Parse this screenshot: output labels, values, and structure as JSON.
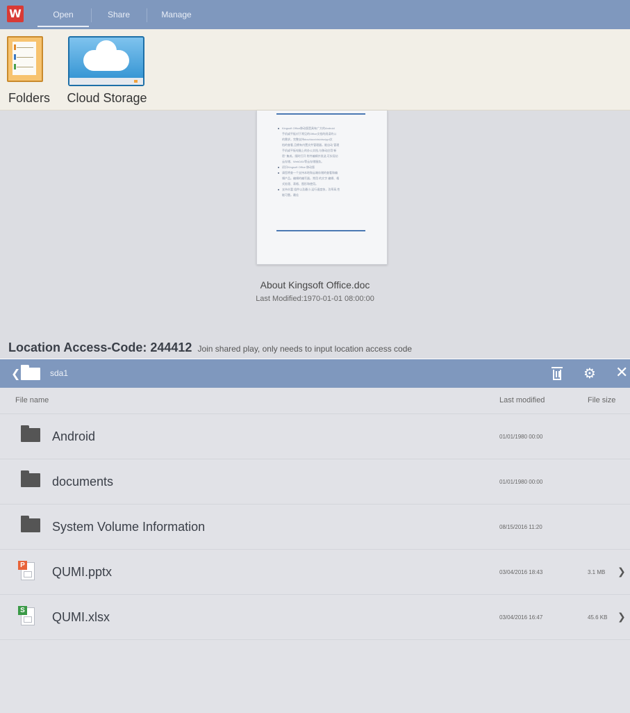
{
  "tabs": [
    "Open",
    "Share",
    "Manage"
  ],
  "ribbon": {
    "folders_label": "Folders",
    "cloud_label": "Cloud Storage"
  },
  "preview": {
    "doc_lines": [
      "Kingsoft Office移动版是具有广大的Android",
      "手机或平板对于常见的Office文档的阅读的公",
      "的需求，完整支持doc/docx/xls/xlsx/ppt文",
      "档的查看,且拥有内置文件管理器，能自动 管理",
      "手机或平板电脑上的办公文档,与移动应用\"新",
      "密\" 集成，随时打开 附件编辑并发送,可实现访",
      "云存储、WebDAV等云存储服务。",
      "初识Kingsoft Office 移动版",
      "请您将查一个支持本地和云端存储的查看和编",
      "辑产品。编辑的编写器，常用 的文字 编辑、格",
      "式处理、表格、图形和使用。",
      "支持丰富 组件以及最小,运行速度快，功率高,性",
      "能可靠。最佳"
    ],
    "doc_name": "About Kingsoft Office.doc",
    "doc_modified": "Last Modified:1970-01-01 08:00:00"
  },
  "access": {
    "code_label": "Location Access-Code: 244412",
    "hint": "Join shared play, only needs to input location access code"
  },
  "file_browser": {
    "path": "sda1",
    "columns": {
      "name": "File name",
      "modified": "Last modified",
      "size": "File size"
    },
    "rows": [
      {
        "name": "Android",
        "type": "folder",
        "modified": "01/01/1980 00:00",
        "size": ""
      },
      {
        "name": "documents",
        "type": "folder",
        "modified": "01/01/1980 00:00",
        "size": ""
      },
      {
        "name": "System Volume Information",
        "type": "folder",
        "modified": "08/15/2016 11:20",
        "size": ""
      },
      {
        "name": "QUMI.pptx",
        "type": "pptx",
        "modified": "03/04/2016 18:43",
        "size": "3.1 MB"
      },
      {
        "name": "QUMI.xlsx",
        "type": "xlsx",
        "modified": "03/04/2016 16:47",
        "size": "45.6 KB"
      }
    ],
    "icons": {
      "back": "chevron-left-icon",
      "folder": "folder-icon",
      "delete": "trash-icon",
      "settings": "gear-icon",
      "close": "close-icon",
      "open_row": "chevron-right-icon"
    }
  },
  "colors": {
    "header": "#7f98be",
    "brand": "#d93a35",
    "pptx_badge": "#e8643a",
    "xlsx_badge": "#3b9a47"
  }
}
